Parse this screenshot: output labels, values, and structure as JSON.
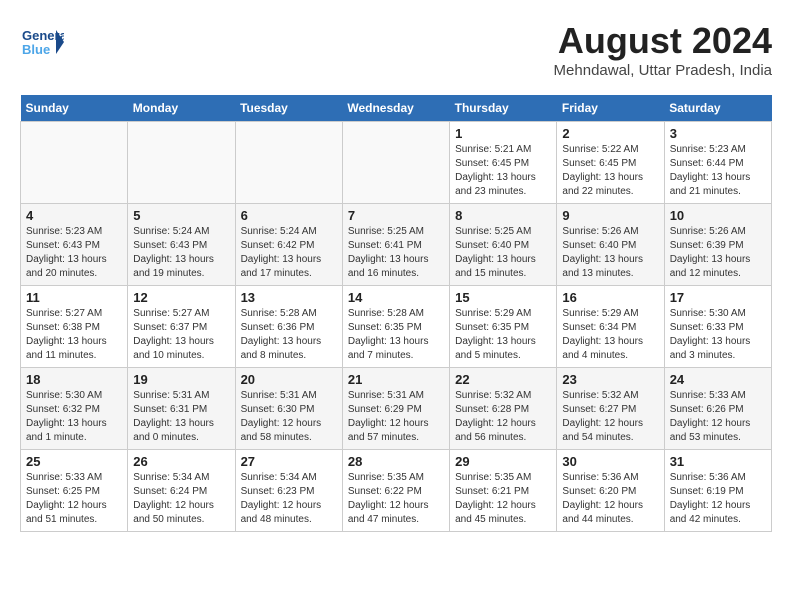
{
  "header": {
    "logo_line1": "General",
    "logo_line2": "Blue",
    "month": "August 2024",
    "location": "Mehndawal, Uttar Pradesh, India"
  },
  "days_of_week": [
    "Sunday",
    "Monday",
    "Tuesday",
    "Wednesday",
    "Thursday",
    "Friday",
    "Saturday"
  ],
  "weeks": [
    [
      {
        "day": "",
        "info": ""
      },
      {
        "day": "",
        "info": ""
      },
      {
        "day": "",
        "info": ""
      },
      {
        "day": "",
        "info": ""
      },
      {
        "day": "1",
        "info": "Sunrise: 5:21 AM\nSunset: 6:45 PM\nDaylight: 13 hours\nand 23 minutes."
      },
      {
        "day": "2",
        "info": "Sunrise: 5:22 AM\nSunset: 6:45 PM\nDaylight: 13 hours\nand 22 minutes."
      },
      {
        "day": "3",
        "info": "Sunrise: 5:23 AM\nSunset: 6:44 PM\nDaylight: 13 hours\nand 21 minutes."
      }
    ],
    [
      {
        "day": "4",
        "info": "Sunrise: 5:23 AM\nSunset: 6:43 PM\nDaylight: 13 hours\nand 20 minutes."
      },
      {
        "day": "5",
        "info": "Sunrise: 5:24 AM\nSunset: 6:43 PM\nDaylight: 13 hours\nand 19 minutes."
      },
      {
        "day": "6",
        "info": "Sunrise: 5:24 AM\nSunset: 6:42 PM\nDaylight: 13 hours\nand 17 minutes."
      },
      {
        "day": "7",
        "info": "Sunrise: 5:25 AM\nSunset: 6:41 PM\nDaylight: 13 hours\nand 16 minutes."
      },
      {
        "day": "8",
        "info": "Sunrise: 5:25 AM\nSunset: 6:40 PM\nDaylight: 13 hours\nand 15 minutes."
      },
      {
        "day": "9",
        "info": "Sunrise: 5:26 AM\nSunset: 6:40 PM\nDaylight: 13 hours\nand 13 minutes."
      },
      {
        "day": "10",
        "info": "Sunrise: 5:26 AM\nSunset: 6:39 PM\nDaylight: 13 hours\nand 12 minutes."
      }
    ],
    [
      {
        "day": "11",
        "info": "Sunrise: 5:27 AM\nSunset: 6:38 PM\nDaylight: 13 hours\nand 11 minutes."
      },
      {
        "day": "12",
        "info": "Sunrise: 5:27 AM\nSunset: 6:37 PM\nDaylight: 13 hours\nand 10 minutes."
      },
      {
        "day": "13",
        "info": "Sunrise: 5:28 AM\nSunset: 6:36 PM\nDaylight: 13 hours\nand 8 minutes."
      },
      {
        "day": "14",
        "info": "Sunrise: 5:28 AM\nSunset: 6:35 PM\nDaylight: 13 hours\nand 7 minutes."
      },
      {
        "day": "15",
        "info": "Sunrise: 5:29 AM\nSunset: 6:35 PM\nDaylight: 13 hours\nand 5 minutes."
      },
      {
        "day": "16",
        "info": "Sunrise: 5:29 AM\nSunset: 6:34 PM\nDaylight: 13 hours\nand 4 minutes."
      },
      {
        "day": "17",
        "info": "Sunrise: 5:30 AM\nSunset: 6:33 PM\nDaylight: 13 hours\nand 3 minutes."
      }
    ],
    [
      {
        "day": "18",
        "info": "Sunrise: 5:30 AM\nSunset: 6:32 PM\nDaylight: 13 hours\nand 1 minute."
      },
      {
        "day": "19",
        "info": "Sunrise: 5:31 AM\nSunset: 6:31 PM\nDaylight: 13 hours\nand 0 minutes."
      },
      {
        "day": "20",
        "info": "Sunrise: 5:31 AM\nSunset: 6:30 PM\nDaylight: 12 hours\nand 58 minutes."
      },
      {
        "day": "21",
        "info": "Sunrise: 5:31 AM\nSunset: 6:29 PM\nDaylight: 12 hours\nand 57 minutes."
      },
      {
        "day": "22",
        "info": "Sunrise: 5:32 AM\nSunset: 6:28 PM\nDaylight: 12 hours\nand 56 minutes."
      },
      {
        "day": "23",
        "info": "Sunrise: 5:32 AM\nSunset: 6:27 PM\nDaylight: 12 hours\nand 54 minutes."
      },
      {
        "day": "24",
        "info": "Sunrise: 5:33 AM\nSunset: 6:26 PM\nDaylight: 12 hours\nand 53 minutes."
      }
    ],
    [
      {
        "day": "25",
        "info": "Sunrise: 5:33 AM\nSunset: 6:25 PM\nDaylight: 12 hours\nand 51 minutes."
      },
      {
        "day": "26",
        "info": "Sunrise: 5:34 AM\nSunset: 6:24 PM\nDaylight: 12 hours\nand 50 minutes."
      },
      {
        "day": "27",
        "info": "Sunrise: 5:34 AM\nSunset: 6:23 PM\nDaylight: 12 hours\nand 48 minutes."
      },
      {
        "day": "28",
        "info": "Sunrise: 5:35 AM\nSunset: 6:22 PM\nDaylight: 12 hours\nand 47 minutes."
      },
      {
        "day": "29",
        "info": "Sunrise: 5:35 AM\nSunset: 6:21 PM\nDaylight: 12 hours\nand 45 minutes."
      },
      {
        "day": "30",
        "info": "Sunrise: 5:36 AM\nSunset: 6:20 PM\nDaylight: 12 hours\nand 44 minutes."
      },
      {
        "day": "31",
        "info": "Sunrise: 5:36 AM\nSunset: 6:19 PM\nDaylight: 12 hours\nand 42 minutes."
      }
    ]
  ]
}
